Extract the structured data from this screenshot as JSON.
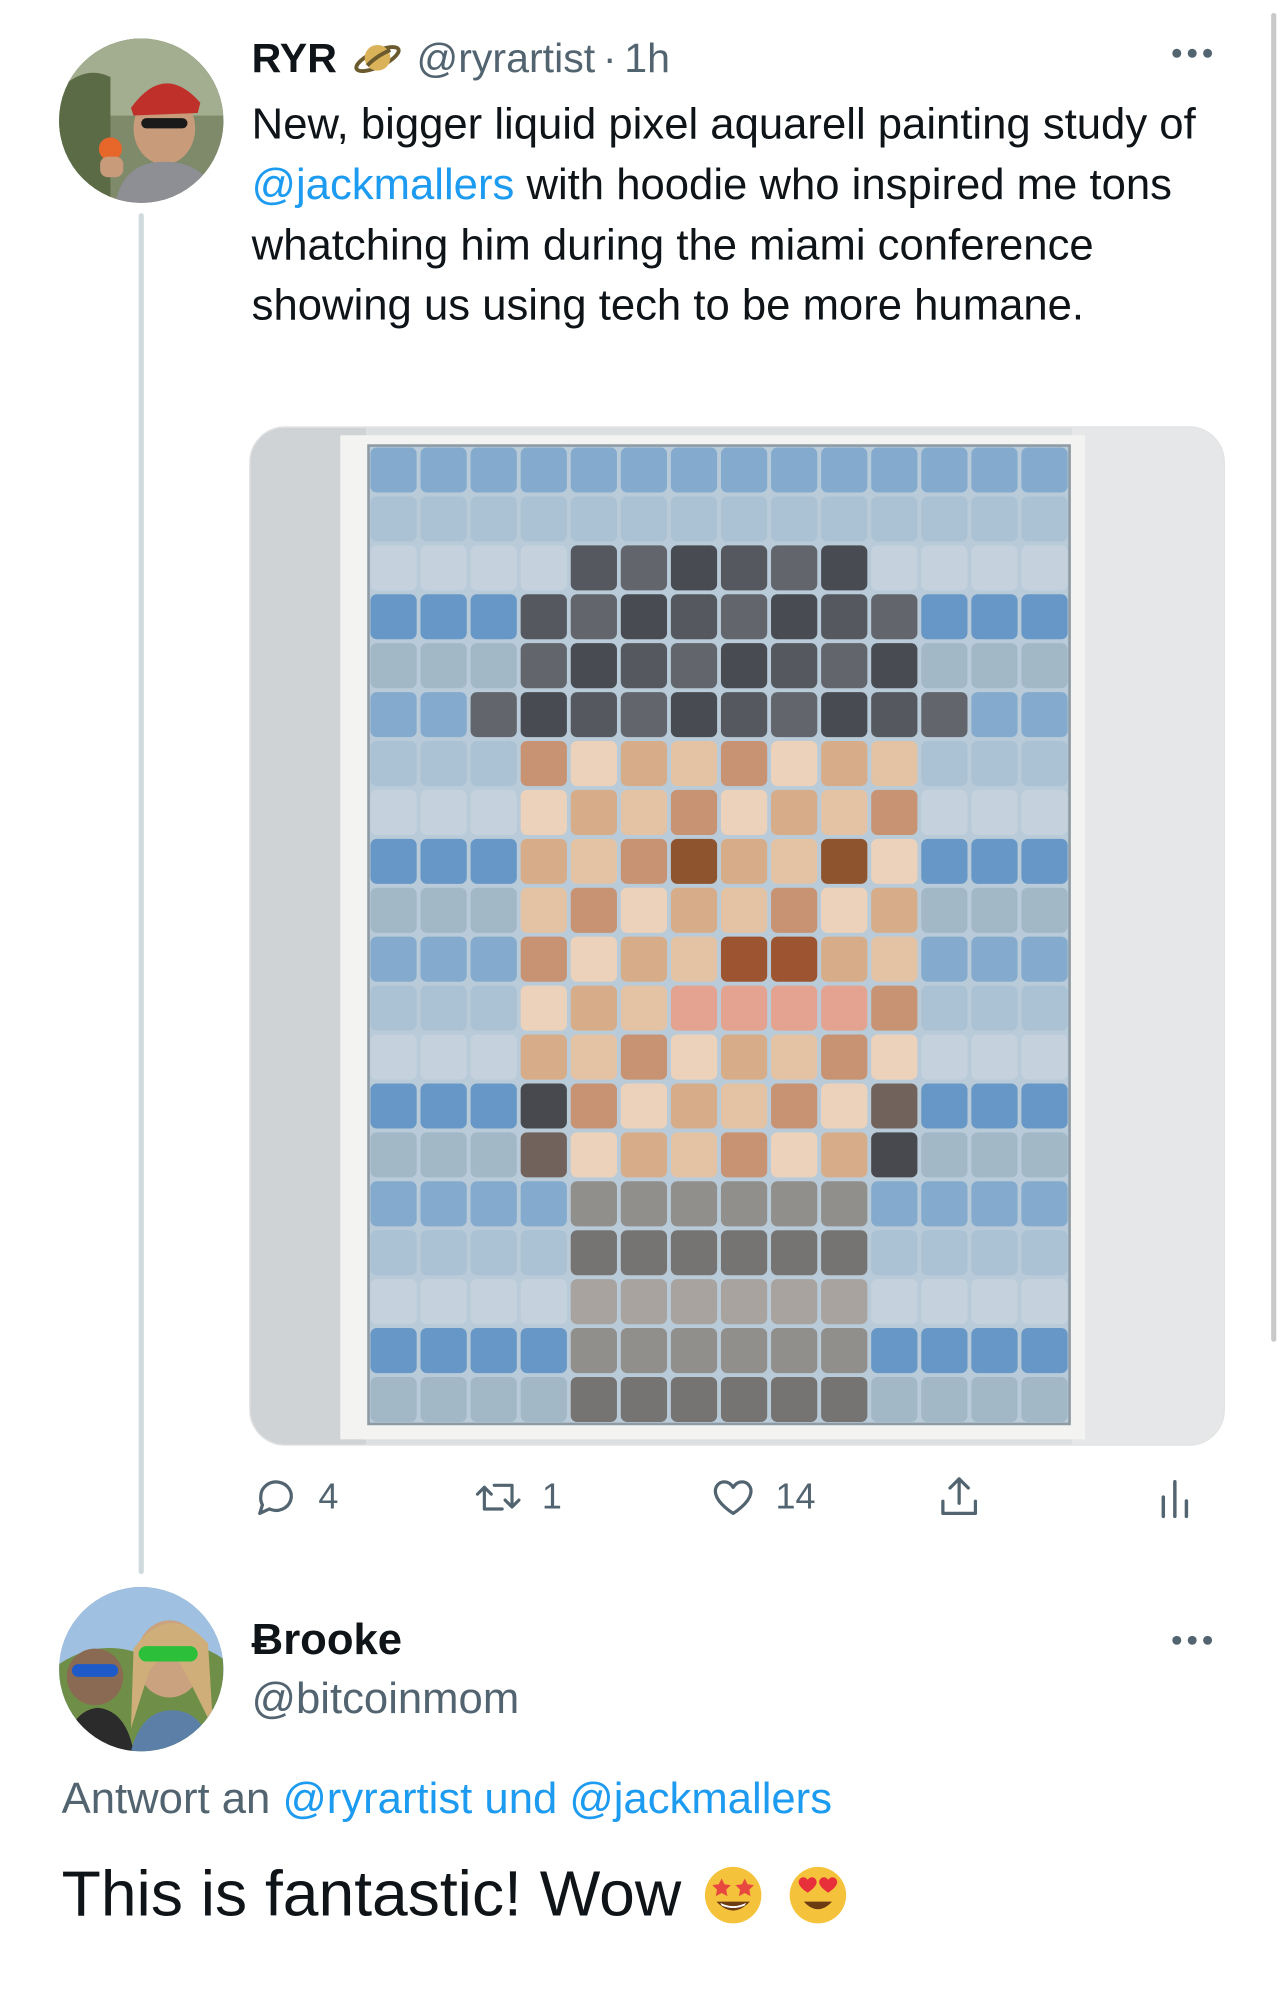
{
  "tweet": {
    "display_name": "RYR",
    "name_emoji": "ringed-planet-emoji",
    "handle": "@ryrartist",
    "separator": "·",
    "time": "1h",
    "text_parts": {
      "before": "New, bigger liquid pixel aquarell painting study of ",
      "mention": "@jackmallers",
      "after": " with hoodie who inspired me tons whatching him during the miami conference showing us using tech to be more humane."
    },
    "media": {
      "description_icon": "pixel-watercolor-portrait-image"
    },
    "actions": {
      "reply_count": "4",
      "retweet_count": "1",
      "like_count": "14"
    }
  },
  "reply": {
    "display_name": "Ƀrooke",
    "handle": "@bitcoinmom",
    "reply_prefix": "Antwort an ",
    "reply_mention_1": "@ryrartist",
    "reply_joiner": " und ",
    "reply_mention_2": "@jackmallers",
    "text": "This is fantastic! Wow",
    "emojis": [
      "star-struck-emoji",
      "heart-eyes-emoji"
    ]
  },
  "colors": {
    "link": "#1d9bf0",
    "secondary_text": "#536471",
    "primary_text": "#0f1419",
    "thread_line": "#cfd9de"
  }
}
